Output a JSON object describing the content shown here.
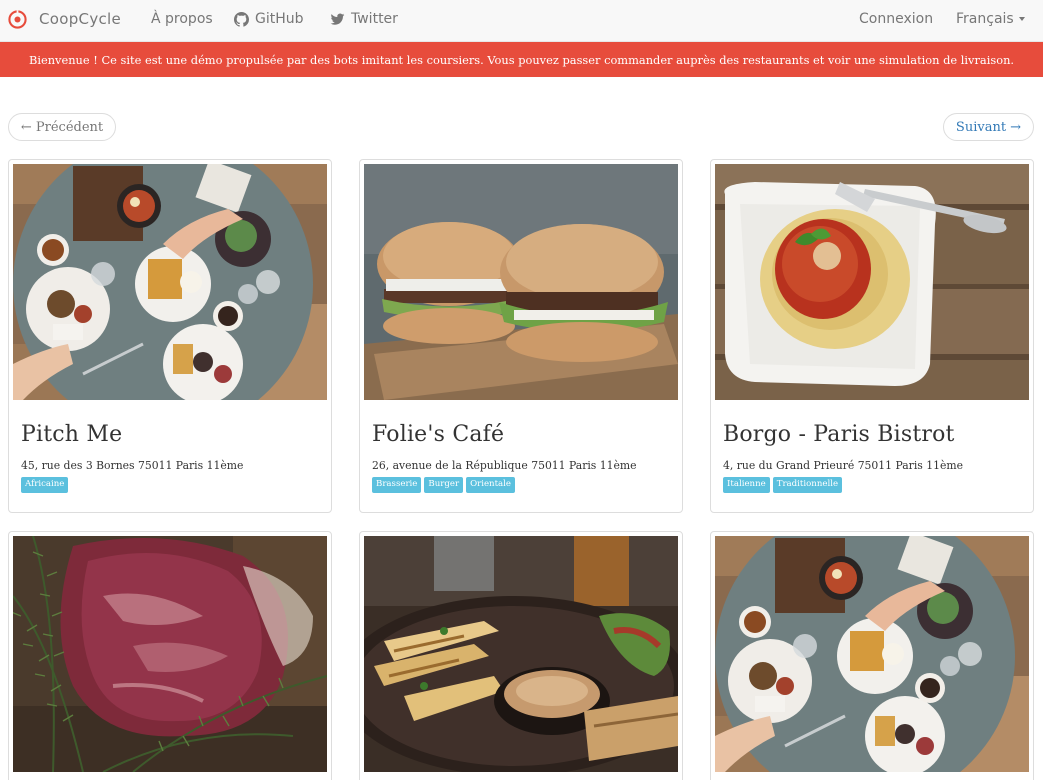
{
  "navbar": {
    "brand": "CoopCycle",
    "about": "À propos",
    "github": "GitHub",
    "twitter": "Twitter",
    "login": "Connexion",
    "language": "Français",
    "logo_color": "#e74c3c"
  },
  "banner": {
    "text": "Bienvenue ! Ce site est une démo propulsée par des bots imitant les coursiers. Vous pouvez passer commander auprès des restaurants et voir une simulation de livraison.",
    "color": "#e74c3c"
  },
  "pager": {
    "previous": "← Précédent",
    "next": "Suivant →"
  },
  "restaurants": [
    {
      "name": "Pitch Me",
      "address": "45, rue des 3 Bornes 75011 Paris 11ème",
      "tags": [
        "Africaine"
      ],
      "image": "brunch-table-photo"
    },
    {
      "name": "Folie's Café",
      "address": "26, avenue de la République 75011 Paris 11ème",
      "tags": [
        "Brasserie",
        "Burger",
        "Orientale"
      ],
      "image": "burgers-photo"
    },
    {
      "name": "Borgo - Paris Bistrot",
      "address": "4, rue du Grand Prieuré 75011 Paris 11ème",
      "tags": [
        "Italienne",
        "Traditionnelle"
      ],
      "image": "spaghetti-photo"
    },
    {
      "name": "",
      "address": "",
      "tags": [],
      "image": "raw-beef-rosemary-photo"
    },
    {
      "name": "",
      "address": "",
      "tags": [],
      "image": "grilled-platter-photo"
    },
    {
      "name": "",
      "address": "",
      "tags": [],
      "image": "brunch-table-photo"
    }
  ],
  "colors": {
    "tag": "#5bc0de",
    "link": "#337ab7",
    "navbar_bg": "#f8f8f8"
  }
}
